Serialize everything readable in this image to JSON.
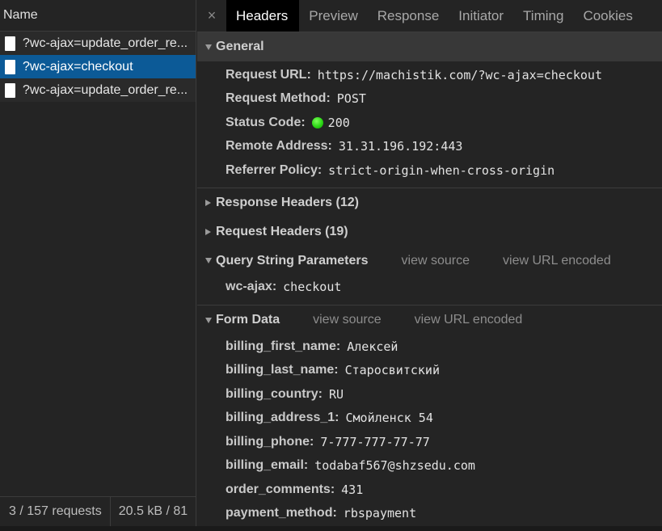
{
  "left": {
    "header": "Name",
    "requests": [
      {
        "name": "?wc-ajax=update_order_re..."
      },
      {
        "name": "?wc-ajax=checkout"
      },
      {
        "name": "?wc-ajax=update_order_re..."
      }
    ],
    "footer_requests": "3 / 157 requests",
    "footer_size": "20.5 kB / 81"
  },
  "tabs": {
    "close": "×",
    "items": [
      "Headers",
      "Preview",
      "Response",
      "Initiator",
      "Timing",
      "Cookies"
    ],
    "active": "Headers"
  },
  "general": {
    "title": "General",
    "rows": [
      {
        "key": "Request URL:",
        "value": "https://machistik.com/?wc-ajax=checkout"
      },
      {
        "key": "Request Method:",
        "value": "POST"
      },
      {
        "key": "Status Code:",
        "value": "200",
        "status_color": "#2bd615"
      },
      {
        "key": "Remote Address:",
        "value": "31.31.196.192:443"
      },
      {
        "key": "Referrer Policy:",
        "value": "strict-origin-when-cross-origin"
      }
    ]
  },
  "response_headers": {
    "title": "Response Headers (12)"
  },
  "request_headers": {
    "title": "Request Headers (19)"
  },
  "query": {
    "title": "Query String Parameters",
    "view_source": "view source",
    "view_url_encoded": "view URL encoded",
    "rows": [
      {
        "key": "wc-ajax:",
        "value": "checkout"
      }
    ]
  },
  "form": {
    "title": "Form Data",
    "view_source": "view source",
    "view_url_encoded": "view URL encoded",
    "rows": [
      {
        "key": "billing_first_name:",
        "value": "Алексей"
      },
      {
        "key": "billing_last_name:",
        "value": "Старосвитский"
      },
      {
        "key": "billing_country:",
        "value": "RU"
      },
      {
        "key": "billing_address_1:",
        "value": "Смойленск 54"
      },
      {
        "key": "billing_phone:",
        "value": "7-777-777-77-77"
      },
      {
        "key": "billing_email:",
        "value": "todabaf567@shzsedu.com"
      },
      {
        "key": "order_comments:",
        "value": "431"
      },
      {
        "key": "payment_method:",
        "value": "rbspayment"
      }
    ]
  },
  "colors": {
    "selected_row": "#0c5a97",
    "panel_bg": "#242424",
    "section_bg": "#383838"
  }
}
